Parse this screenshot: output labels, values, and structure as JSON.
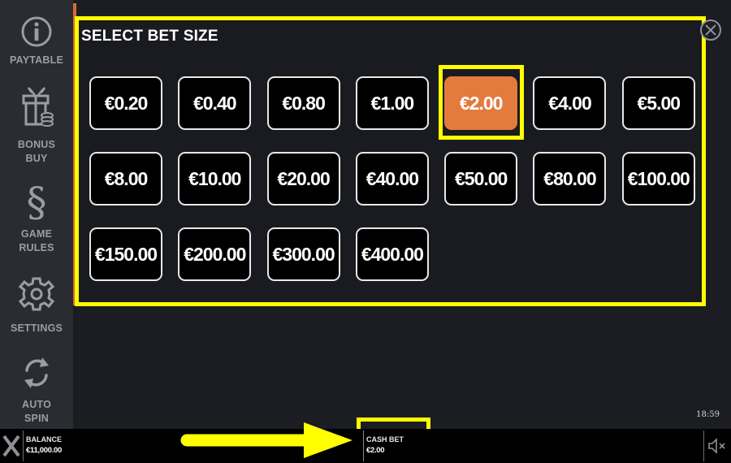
{
  "sidebar": {
    "items": [
      {
        "label_line1": "PAYTABLE",
        "label_line2": "",
        "icon": "info-icon"
      },
      {
        "label_line1": "BONUS",
        "label_line2": "BUY",
        "icon": "gift-icon"
      },
      {
        "label_line1": "GAME",
        "label_line2": "RULES",
        "icon": "section-sign-icon"
      },
      {
        "label_line1": "SETTINGS",
        "label_line2": "",
        "icon": "gear-icon"
      },
      {
        "label_line1": "AUTO",
        "label_line2": "SPIN",
        "icon": "autospin-icon"
      }
    ]
  },
  "panel": {
    "title": "SELECT BET SIZE",
    "bets": [
      "€0.20",
      "€0.40",
      "€0.80",
      "€1.00",
      "€2.00",
      "€4.00",
      "€5.00",
      "€8.00",
      "€10.00",
      "€20.00",
      "€40.00",
      "€50.00",
      "€80.00",
      "€100.00",
      "€150.00",
      "€200.00",
      "€300.00",
      "€400.00"
    ],
    "selected_bet": "€2.00"
  },
  "clock": "18:59",
  "bottom_bar": {
    "balance_label": "BALANCE",
    "balance_value": "€11,000.00",
    "cash_bet_label": "CASH BET",
    "cash_bet_value": "€2.00"
  },
  "colors": {
    "accent_orange": "#e37a3e",
    "highlight_yellow": "#ffff00",
    "sidebar_bg": "#2a2c32",
    "panel_bg": "#1a1b20"
  }
}
